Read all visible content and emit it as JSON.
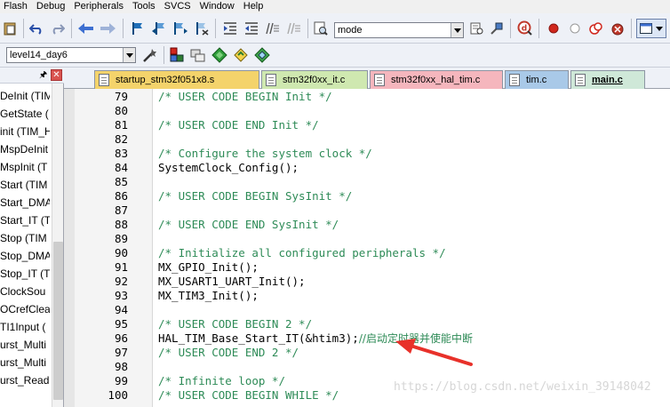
{
  "menu": [
    "Flash",
    "Debug",
    "Peripherals",
    "Tools",
    "SVCS",
    "Window",
    "Help"
  ],
  "toolbar": {
    "find_combo_value": "mode",
    "target_combo_value": "level14_day6"
  },
  "colors": {
    "comment": "#2e8b57",
    "arrow": "#e8312a",
    "tab_startup": "#f4d36b",
    "tab_it": "#cfe8b0",
    "tab_hal_tim": "#f5b6bd",
    "tab_tim": "#a9c9e8",
    "tab_main": "#cfe8d8"
  },
  "icons": {
    "toolbar1": [
      "undo-icon",
      "redo-icon",
      "back-icon",
      "forward-icon",
      "bookmark-icon",
      "bookmark-prev-icon",
      "bookmark-next-icon",
      "bookmark-clear-icon",
      "indent-icon",
      "outdent-icon",
      "comment-icon",
      "uncomment-icon",
      "find-in-files-icon",
      "find-icon",
      "search-icon",
      "debug-icon",
      "breakpoint-icon",
      "disable-breakpoint-icon",
      "kill-breakpoints-icon",
      "config-icon",
      "window-icon"
    ],
    "toolbar2": [
      "options-for-target-icon",
      "manage-components-icon",
      "file-extensions-icon",
      "pack-installer-icon",
      "green-diamond-icon",
      "select-software-packs-icon"
    ]
  },
  "panel": {
    "functions": [
      "DeInit (TIM",
      "GetState (",
      "init (TIM_H",
      "MspDeInit",
      "MspInit (T",
      "Start (TIM",
      "Start_DMA",
      "Start_IT (T",
      "Stop (TIM",
      "Stop_DMA",
      "Stop_IT (T",
      "ClockSou",
      "OCrefClea",
      "TI1Input (",
      "urst_Multi",
      "urst_Multi",
      "urst_Read"
    ]
  },
  "tabs": [
    {
      "label": "startup_stm32f051x8.s"
    },
    {
      "label": "stm32f0xx_it.c"
    },
    {
      "label": "stm32f0xx_hal_tim.c"
    },
    {
      "label": "tim.c"
    },
    {
      "label": "main.c"
    }
  ],
  "code": {
    "lines": [
      {
        "num": "79",
        "text": "/* USER CODE BEGIN Init */",
        "kind": "comment"
      },
      {
        "num": "80",
        "text": "",
        "kind": "code"
      },
      {
        "num": "81",
        "text": "/* USER CODE END Init */",
        "kind": "comment"
      },
      {
        "num": "82",
        "text": "",
        "kind": "code"
      },
      {
        "num": "83",
        "text": "/* Configure the system clock */",
        "kind": "comment"
      },
      {
        "num": "84",
        "text": "SystemClock_Config();",
        "kind": "code"
      },
      {
        "num": "85",
        "text": "",
        "kind": "code"
      },
      {
        "num": "86",
        "text": "/* USER CODE BEGIN SysInit */",
        "kind": "comment"
      },
      {
        "num": "87",
        "text": "",
        "kind": "code"
      },
      {
        "num": "88",
        "text": "/* USER CODE END SysInit */",
        "kind": "comment"
      },
      {
        "num": "89",
        "text": "",
        "kind": "code"
      },
      {
        "num": "90",
        "text": "/* Initialize all configured peripherals */",
        "kind": "comment"
      },
      {
        "num": "91",
        "text": "MX_GPIO_Init();",
        "kind": "code"
      },
      {
        "num": "92",
        "text": "MX_USART1_UART_Init();",
        "kind": "code"
      },
      {
        "num": "93",
        "text": "MX_TIM3_Init();",
        "kind": "code"
      },
      {
        "num": "94",
        "text": "",
        "kind": "code"
      },
      {
        "num": "95",
        "text": "/* USER CODE BEGIN 2 */",
        "kind": "comment"
      },
      {
        "num": "96",
        "text": "HAL_TIM_Base_Start_IT(&htim3);",
        "kind": "code",
        "trailing": "//启动定时器并使能中断"
      },
      {
        "num": "97",
        "text": "/* USER CODE END 2 */",
        "kind": "comment"
      },
      {
        "num": "98",
        "text": "",
        "kind": "code"
      },
      {
        "num": "99",
        "text": "/* Infinite loop */",
        "kind": "comment"
      },
      {
        "num": "100",
        "text": "/* USER CODE BEGIN WHILE */",
        "kind": "comment"
      }
    ]
  },
  "watermark": "https://blog.csdn.net/weixin_39148042"
}
